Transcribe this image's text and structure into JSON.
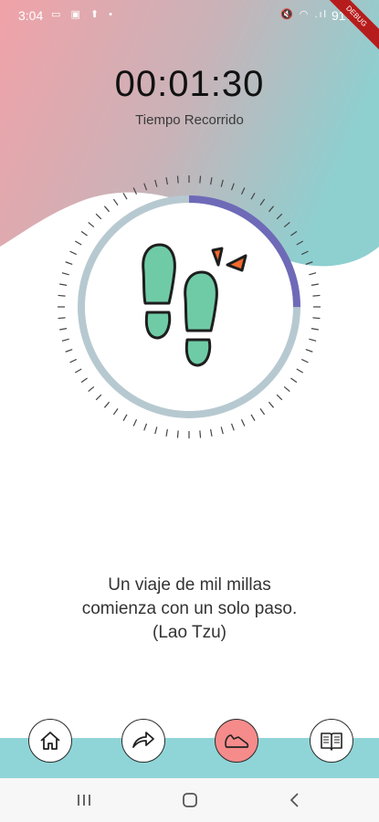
{
  "status_bar": {
    "time": "3:04",
    "left_icons": "▭ ▣ ⬆ •",
    "right_icons": "🔇 ◠ .ıl",
    "battery": "91%"
  },
  "debug_banner": "DEBUG",
  "timer": {
    "elapsed": "00:01:30",
    "label": "Tiempo Recorrido",
    "progress_fraction": 0.25
  },
  "quote": {
    "line1": "Un viaje de mil millas",
    "line2": "comienza con un solo paso.",
    "line3": "(Lao Tzu)"
  },
  "bottom_nav": {
    "items": [
      {
        "name": "home",
        "active": false
      },
      {
        "name": "share",
        "active": false
      },
      {
        "name": "walk",
        "active": true
      },
      {
        "name": "journal",
        "active": false
      }
    ]
  },
  "colors": {
    "gradient_start": "#f0a2a8",
    "gradient_end": "#8ecfd0",
    "progress_track": "#b7c9d0",
    "progress_fill": "#6e6ab7",
    "footprint_green": "#6fcba6",
    "accent_orange": "#f06a2d",
    "bottom_bar": "#8fd5d7",
    "active_button": "#f58b8b"
  }
}
